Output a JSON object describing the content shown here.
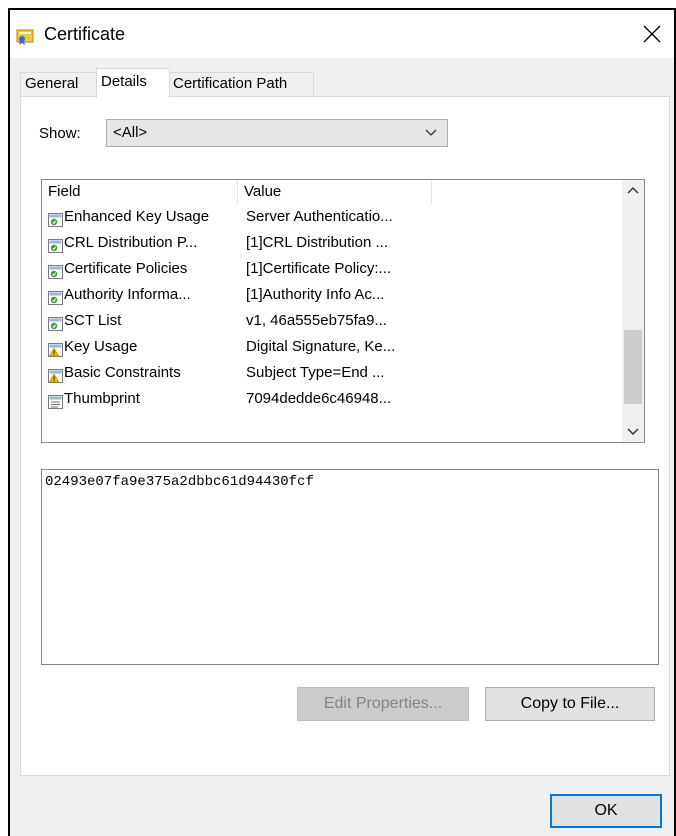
{
  "window": {
    "title": "Certificate",
    "close_glyph": "✕"
  },
  "tabs": [
    {
      "label": "General",
      "active": false
    },
    {
      "label": "Details",
      "active": true
    },
    {
      "label": "Certification Path",
      "active": false
    }
  ],
  "show": {
    "label": "Show:",
    "value": "<All>"
  },
  "list": {
    "columns": {
      "field": "Field",
      "value": "Value"
    },
    "rows": [
      {
        "icon": "extension-icon",
        "field": "Enhanced Key Usage",
        "value": "Server Authenticatio..."
      },
      {
        "icon": "extension-icon",
        "field": "CRL Distribution P...",
        "value": "[1]CRL Distribution ..."
      },
      {
        "icon": "extension-icon",
        "field": "Certificate Policies",
        "value": "[1]Certificate Policy:..."
      },
      {
        "icon": "extension-icon",
        "field": "Authority Informa...",
        "value": "[1]Authority Info Ac..."
      },
      {
        "icon": "extension-icon",
        "field": "SCT List",
        "value": "v1, 46a555eb75fa9..."
      },
      {
        "icon": "critical-extension-icon",
        "field": "Key Usage",
        "value": "Digital Signature, Ke..."
      },
      {
        "icon": "critical-extension-icon",
        "field": "Basic Constraints",
        "value": "Subject Type=End ..."
      },
      {
        "icon": "property-icon",
        "field": "Thumbprint",
        "value": "7094dedde6c46948..."
      }
    ]
  },
  "detail_value": "02493e07fa9e375a2dbbc61d94430fcf",
  "buttons": {
    "edit_properties": "Edit Properties...",
    "copy_to_file": "Copy to File...",
    "ok": "OK"
  },
  "colors": {
    "focus_border": "#0078d7",
    "disabled_button": "#cccccc",
    "panel_bg": "#f0f0f0"
  }
}
